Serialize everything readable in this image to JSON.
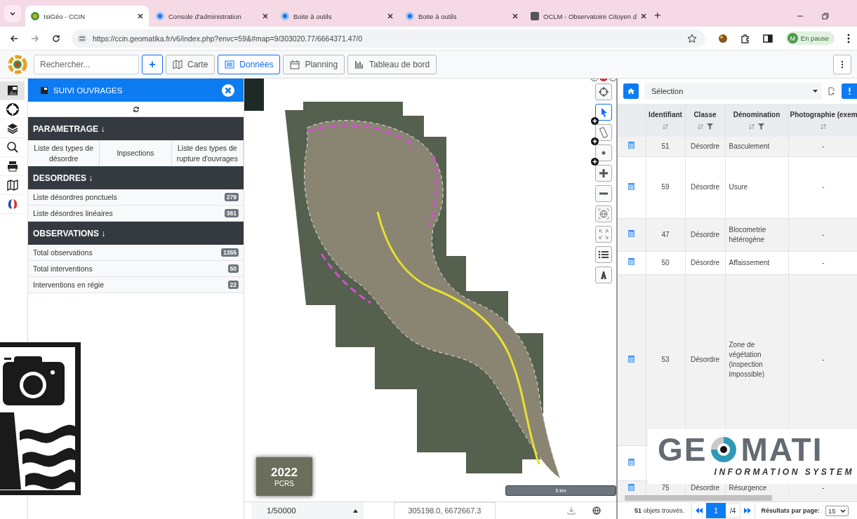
{
  "browser": {
    "tabs": [
      {
        "title": "IsiGéo - CCIN",
        "selected": true
      },
      {
        "title": "Console d'administration",
        "selected": false
      },
      {
        "title": "Boite à outils",
        "selected": false
      },
      {
        "title": "Boite à outils",
        "selected": false
      },
      {
        "title": "OCLM - Observatoire Citoyen d",
        "selected": false
      }
    ],
    "new_tab": "+",
    "url": "https://ccin.geomatika.fr/v6/index.php?envc=59&#map=9/303020.77/6664371.47/0",
    "profile": {
      "initial": "M",
      "label": "En pause"
    }
  },
  "toolbar": {
    "search": {
      "placeholder": "Rechercher..."
    },
    "add": "+",
    "buttons": [
      {
        "label": "Carte",
        "selected": false
      },
      {
        "label": "Données",
        "selected": true
      },
      {
        "label": "Planning",
        "selected": false
      },
      {
        "label": "Tableau de bord",
        "selected": false
      }
    ]
  },
  "sidebar_icons": [
    {
      "kind": "camera",
      "selected": true
    },
    {
      "kind": "lifebuoy",
      "selected": false
    },
    {
      "kind": "layers",
      "selected": false
    },
    {
      "kind": "search",
      "selected": false
    },
    {
      "kind": "print",
      "selected": false
    },
    {
      "kind": "map",
      "selected": false
    },
    {
      "kind": "flag",
      "selected": false
    }
  ],
  "panel": {
    "title": "SUIVI OUVRAGES",
    "sections": [
      {
        "title": "PARAMETRAGE ↓",
        "kind": "grid",
        "cells": [
          "Liste des types de désordre",
          "Inpsections",
          "Liste des types de rupture d'ouvrages"
        ]
      },
      {
        "title": "DESORDRES ↓",
        "kind": "list",
        "items": [
          {
            "label": "Liste désordres ponctuels",
            "count": "279"
          },
          {
            "label": "Liste désordres linéaires",
            "count": "361"
          }
        ]
      },
      {
        "title": "OBSERVATIONS ↓",
        "kind": "list",
        "items": [
          {
            "label": "Total observations",
            "count": "1355"
          },
          {
            "label": "Total interventions",
            "count": "50"
          },
          {
            "label": "Interventions en régie",
            "count": "22"
          }
        ]
      }
    ]
  },
  "map": {
    "basemap": {
      "year": "2022",
      "name": "PCRS"
    },
    "scale_bar": "5 km",
    "tools": [
      {
        "kind": "locate",
        "selected": false
      },
      {
        "kind": "pointer",
        "selected": true
      },
      {
        "kind": "ruler",
        "selected": false
      },
      {
        "kind": "point",
        "selected": false
      },
      {
        "kind": "zoom-in",
        "selected": false
      },
      {
        "kind": "zoom-out",
        "selected": false
      },
      {
        "kind": "globe",
        "selected": false
      },
      {
        "kind": "extent",
        "selected": false
      },
      {
        "kind": "list",
        "selected": false
      },
      {
        "kind": "road",
        "selected": false
      }
    ],
    "status": {
      "scale": "1/50000",
      "coordinates": "305198.0, 6672667.3"
    }
  },
  "selection": {
    "layer": "Sélection",
    "columns": [
      "Identifiant",
      "Classe",
      "Dénomination",
      "Photographie (exem"
    ],
    "rows": [
      {
        "id": "51",
        "classe": "Désordre",
        "denomination": "Basculement",
        "photo": "-"
      },
      {
        "id": "59",
        "classe": "Désordre",
        "denomination": "Usure",
        "photo": "-"
      },
      {
        "id": "47",
        "classe": "Désordre",
        "denomination": "Blocometrie hétérogène",
        "photo": "-"
      },
      {
        "id": "50",
        "classe": "Désordre",
        "denomination": "Affaissement",
        "photo": "-"
      },
      {
        "id": "53",
        "classe": "Désordre",
        "denomination": "Zone de végétation (inspection impossible)",
        "photo": "-"
      },
      {},
      {
        "id": "75",
        "classe": "Désordre",
        "denomination": "Résurgence",
        "photo": "-"
      }
    ],
    "found": "**51** objets trouvés.",
    "page": "1",
    "pages": "/4",
    "per_page_label": "Résultats par page:",
    "per_page": "15"
  },
  "overlays": {
    "geomatika_logo": {
      "left": "GE",
      "right": "MATI",
      "tagline": "INFORMATION SYSTEM"
    }
  }
}
